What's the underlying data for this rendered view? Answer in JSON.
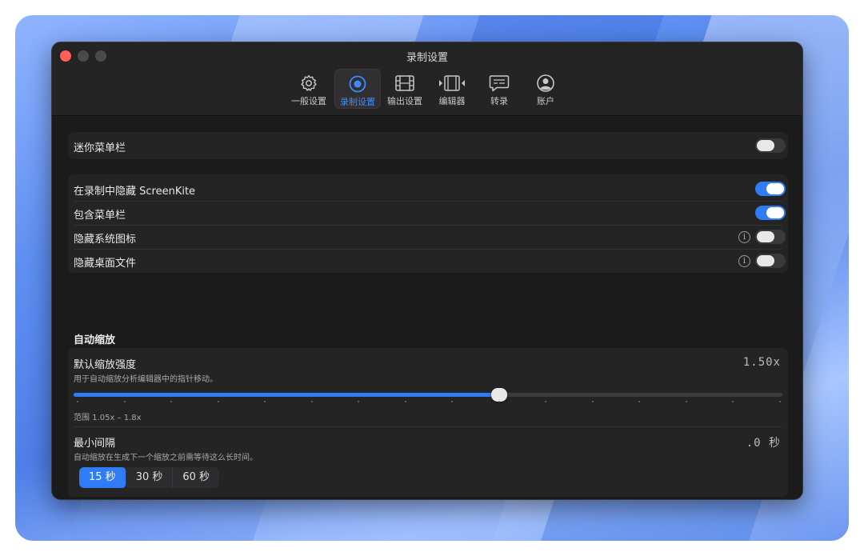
{
  "window": {
    "title": "录制设置"
  },
  "tabs": [
    {
      "label": "一般设置",
      "icon": "gear-icon"
    },
    {
      "label": "录制设置",
      "icon": "record-icon",
      "active": true
    },
    {
      "label": "输出设置",
      "icon": "film-icon"
    },
    {
      "label": "编辑器",
      "icon": "editor-icon"
    },
    {
      "label": "转录",
      "icon": "caption-icon"
    },
    {
      "label": "账户",
      "icon": "account-icon"
    }
  ],
  "mini_menubar": {
    "label": "迷你菜单栏",
    "enabled": false
  },
  "recording_options": [
    {
      "label": "在录制中隐藏 ScreenKite",
      "enabled": true,
      "info": false
    },
    {
      "label": "包含菜单栏",
      "enabled": true,
      "info": false
    },
    {
      "label": "隐藏系统图标",
      "enabled": false,
      "info": true
    },
    {
      "label": "隐藏桌面文件",
      "enabled": false,
      "info": true
    }
  ],
  "info_glyph": "i",
  "auto_zoom": {
    "section_title": "自动缩放",
    "strength": {
      "title": "默认缩放强度",
      "description": "用于自动缩放分析编辑器中的指针移动。",
      "value_text": "1.50x",
      "value": 1.5,
      "min": 1.05,
      "max": 1.8,
      "range_text": "范围 1.05x – 1.8x"
    },
    "interval": {
      "title": "最小间隔",
      "description": "自动缩放在生成下一个缩放之前需等待这么长时间。",
      "value_text": ".0 秒",
      "options": [
        "15 秒",
        "30 秒",
        "60 秒"
      ],
      "selected": "15 秒"
    }
  },
  "colors": {
    "accent": "#2f7cf6",
    "window_bg": "#1e1e1f",
    "close_button": "#ff5f57"
  }
}
